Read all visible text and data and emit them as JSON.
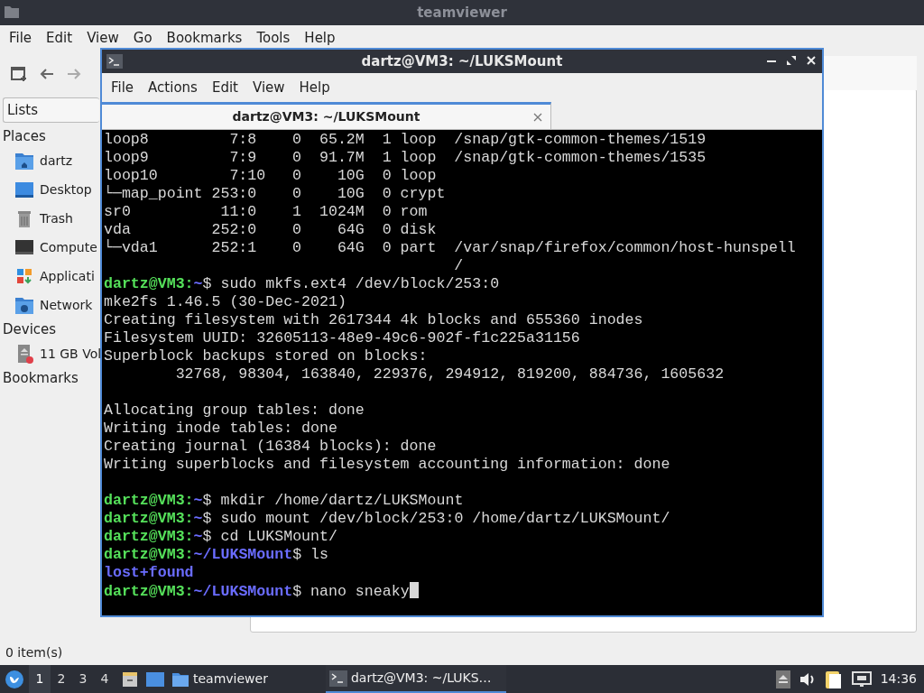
{
  "file_manager": {
    "title": "teamviewer",
    "menu": [
      "File",
      "Edit",
      "View",
      "Go",
      "Bookmarks",
      "Tools",
      "Help"
    ],
    "side_pane_mode": "Lists",
    "sections": [
      {
        "title": "Places",
        "items": [
          {
            "label": "dartz",
            "kind": "home"
          },
          {
            "label": "Desktop",
            "kind": "desktop"
          },
          {
            "label": "Trash",
            "kind": "trash"
          },
          {
            "label": "Compute",
            "kind": "computer"
          },
          {
            "label": "Applicati",
            "kind": "apps"
          },
          {
            "label": "Network",
            "kind": "network"
          }
        ]
      },
      {
        "title": "Devices",
        "items": [
          {
            "label": "11 GB Vol",
            "kind": "drive"
          }
        ]
      },
      {
        "title": "Bookmarks"
      }
    ],
    "status": "0 item(s)"
  },
  "terminal": {
    "title": "dartz@VM3: ~/LUKSMount",
    "menu": [
      "File",
      "Actions",
      "Edit",
      "View",
      "Help"
    ],
    "tabs": [
      {
        "label": "dartz@VM3: ~/LUKSMount",
        "selected": true
      }
    ],
    "lines": [
      {
        "kind": "output",
        "text": "loop8         7:8    0  65.2M  1 loop  /snap/gtk-common-themes/1519"
      },
      {
        "kind": "output",
        "text": "loop9         7:9    0  91.7M  1 loop  /snap/gtk-common-themes/1535"
      },
      {
        "kind": "output",
        "text": "loop10        7:10   0    10G  0 loop"
      },
      {
        "kind": "output",
        "text": "└─map_point 253:0    0    10G  0 crypt"
      },
      {
        "kind": "output",
        "text": "sr0          11:0    1  1024M  0 rom"
      },
      {
        "kind": "output",
        "text": "vda         252:0    0    64G  0 disk"
      },
      {
        "kind": "output",
        "text": "└─vda1      252:1    0    64G  0 part  /var/snap/firefox/common/host-hunspell"
      },
      {
        "kind": "output",
        "text": "                                       /"
      },
      {
        "kind": "prompt",
        "user": "dartz@VM3:",
        "path": "~",
        "command": "$ sudo mkfs.ext4 /dev/block/253:0"
      },
      {
        "kind": "output",
        "text": "mke2fs 1.46.5 (30-Dec-2021)"
      },
      {
        "kind": "output",
        "text": "Creating filesystem with 2617344 4k blocks and 655360 inodes"
      },
      {
        "kind": "output",
        "text": "Filesystem UUID: 32605113-48e9-49c6-902f-f1c225a31156"
      },
      {
        "kind": "output",
        "text": "Superblock backups stored on blocks:"
      },
      {
        "kind": "output",
        "text": "        32768, 98304, 163840, 229376, 294912, 819200, 884736, 1605632"
      },
      {
        "kind": "blank"
      },
      {
        "kind": "output",
        "text": "Allocating group tables: done"
      },
      {
        "kind": "output",
        "text": "Writing inode tables: done"
      },
      {
        "kind": "output",
        "text": "Creating journal (16384 blocks): done"
      },
      {
        "kind": "output",
        "text": "Writing superblocks and filesystem accounting information: done"
      },
      {
        "kind": "blank"
      },
      {
        "kind": "prompt",
        "user": "dartz@VM3:",
        "path": "~",
        "command": "$ mkdir /home/dartz/LUKSMount"
      },
      {
        "kind": "prompt",
        "user": "dartz@VM3:",
        "path": "~",
        "command": "$ sudo mount /dev/block/253:0 /home/dartz/LUKSMount/"
      },
      {
        "kind": "prompt",
        "user": "dartz@VM3:",
        "path": "~",
        "command": "$ cd LUKSMount/"
      },
      {
        "kind": "prompt",
        "user": "dartz@VM3:",
        "path": "~/LUKSMount",
        "command": "$ ls"
      },
      {
        "kind": "dir",
        "text": "lost+found"
      },
      {
        "kind": "prompt",
        "user": "dartz@VM3:",
        "path": "~/LUKSMount",
        "command": "$ nano sneaky",
        "cursor": true
      }
    ]
  },
  "taskbar": {
    "workspaces": [
      {
        "label": "1",
        "selected": true
      },
      {
        "label": "2",
        "selected": false
      },
      {
        "label": "3",
        "selected": false
      },
      {
        "label": "4",
        "selected": false
      }
    ],
    "tasks": [
      {
        "label": "teamviewer",
        "kind": "folder",
        "selected": false
      },
      {
        "label": "dartz@VM3: ~/LUKS…",
        "kind": "terminal",
        "selected": true
      }
    ],
    "clock": "14:36"
  }
}
